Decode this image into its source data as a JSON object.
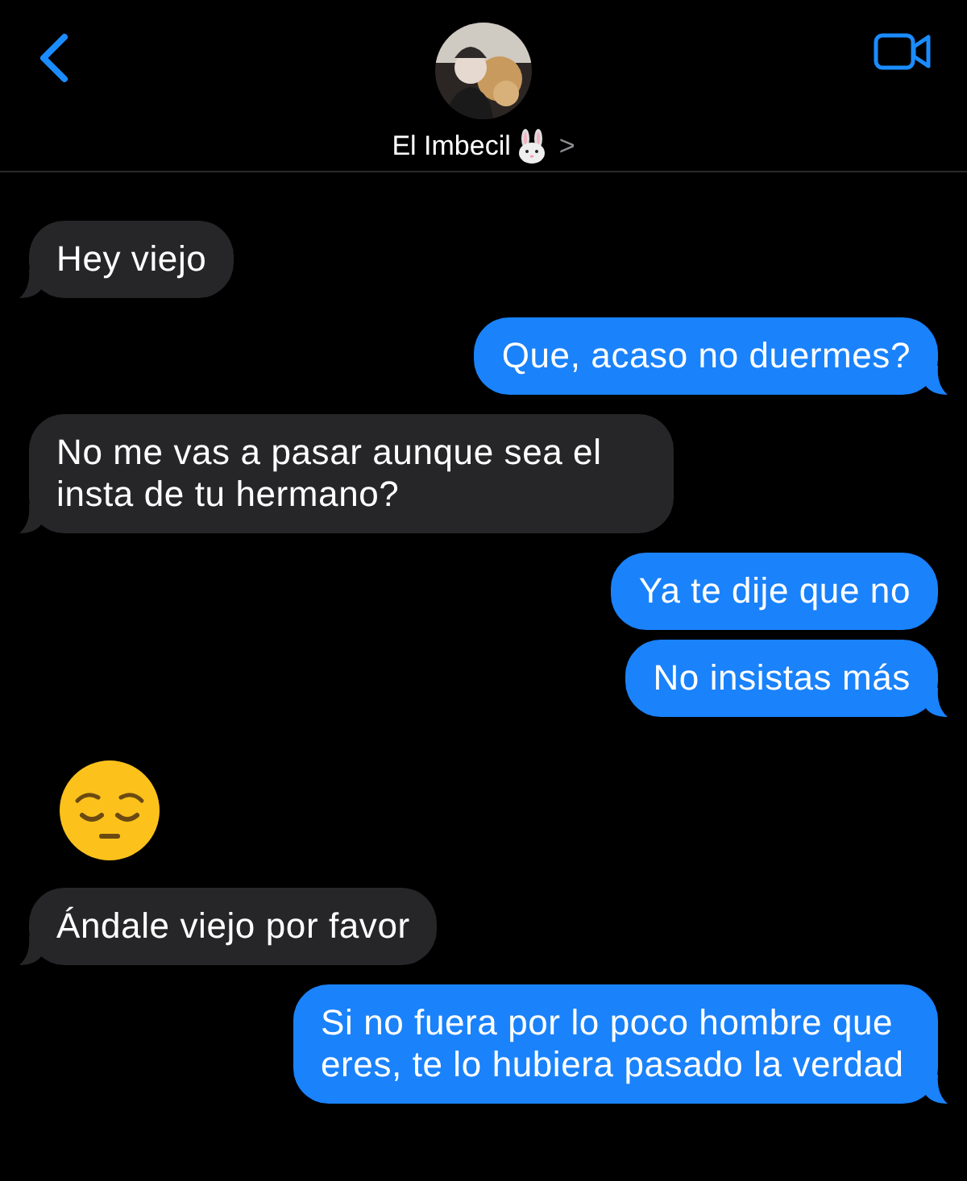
{
  "header": {
    "contact_name": "El Imbecil",
    "chevron": ">"
  },
  "messages": [
    {
      "kind": "text",
      "outgoing": false,
      "tail": true,
      "text": "Hey viejo"
    },
    {
      "kind": "text",
      "outgoing": true,
      "tail": true,
      "text": "Que, acaso no duermes?"
    },
    {
      "kind": "text",
      "outgoing": false,
      "tail": true,
      "text": "No me vas a pasar aunque sea el insta de tu hermano?"
    },
    {
      "kind": "text",
      "outgoing": true,
      "tail": false,
      "text": "Ya te dije que no"
    },
    {
      "kind": "text",
      "outgoing": true,
      "tail": true,
      "text": "No insistas más"
    },
    {
      "kind": "emoji"
    },
    {
      "kind": "text",
      "outgoing": false,
      "tail": true,
      "text": "Ándale viejo por favor"
    },
    {
      "kind": "text",
      "outgoing": true,
      "tail": true,
      "text": "Si no fuera por lo poco hombre que eres, te lo hubiera pasado la verdad"
    }
  ]
}
